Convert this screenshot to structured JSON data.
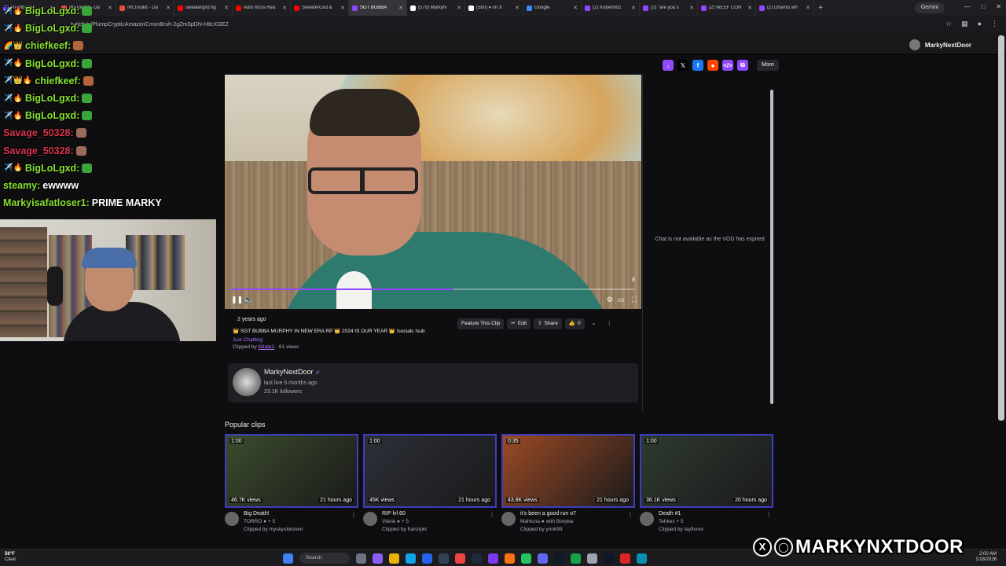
{
  "browser": {
    "tabs": [
      {
        "label": "Dashboard",
        "color": "#9147ff"
      },
      {
        "label": "IRLToolkit - Da",
        "color": "#e74c3c"
      },
      {
        "label": "IRLToolkit - Da",
        "color": "#e74c3c"
      },
      {
        "label": "sweatergxd fig",
        "color": "#ff0000"
      },
      {
        "label": "Adin Ross Rea",
        "color": "#ff0000"
      },
      {
        "label": "SweaterGxd &",
        "color": "#ff0000"
      },
      {
        "label": "SGT BUBBA",
        "color": "#9147ff",
        "active": true
      },
      {
        "label": "(579) MarkyN",
        "color": "#ffffff"
      },
      {
        "label": "(580) ♦ on X",
        "color": "#ffffff"
      },
      {
        "label": "Google",
        "color": "#4285f4"
      },
      {
        "label": "(2) Kobe0802",
        "color": "#9147ff"
      },
      {
        "label": "(2) \"are you s",
        "color": "#9147ff"
      },
      {
        "label": "(2) WEEF CON",
        "color": "#9147ff"
      },
      {
        "label": "(2) Dhamis wh",
        "color": "#9147ff"
      }
    ],
    "gemini_label": "Gemini",
    "url": "twitch.tv/PlumpCrypticAmazonCmonBruh-2gZmSpDN-H8cXGEZ"
  },
  "header": {
    "account_name": "MarkyNextDoor"
  },
  "share": {
    "more_label": "More",
    "buttons": [
      {
        "name": "download-icon",
        "glyph": "↓",
        "color": "#9147ff"
      },
      {
        "name": "x-icon",
        "glyph": "𝕏",
        "color": "#000000"
      },
      {
        "name": "facebook-icon",
        "glyph": "f",
        "color": "#1877f2"
      },
      {
        "name": "reddit-icon",
        "glyph": "●",
        "color": "#ff4500"
      },
      {
        "name": "embed-icon",
        "glyph": "</>",
        "color": "#9147ff"
      },
      {
        "name": "copy-icon",
        "glyph": "⧉",
        "color": "#9147ff"
      }
    ]
  },
  "video": {
    "progress": 0.55,
    "corner_number": "8"
  },
  "clip": {
    "date": "2 years ago",
    "title": "👑 SGT BUBBA MURPHY IN NEW ERA RP 👑 2024 IS OUR YEAR 👑 !socials !sub",
    "game": "Just Chatting",
    "clipped_prefix": "Clipped by ",
    "clipped_by": "lildata1",
    "views": " · 61 views",
    "actions": {
      "feature": "Feature This Clip",
      "edit": "Edit",
      "share": "Share",
      "likes": "0"
    }
  },
  "channel": {
    "name": "MarkyNextDoor",
    "last_live": "last live 5 months ago",
    "followers": "23.1K followers"
  },
  "chat_panel": {
    "message": "Chat is not available as the VOD has expired"
  },
  "popular": {
    "heading": "Popular clips",
    "clips": [
      {
        "duration": "1:00",
        "views": "46.7K views",
        "ago": "21 hours ago",
        "title": "Big Death!",
        "channel": "TORRO ● + 5",
        "by": "Clipped by myskyukkonen",
        "bg": "#3b4b2c"
      },
      {
        "duration": "1:00",
        "views": "45K views",
        "ago": "21 hours ago",
        "title": "RIP lvl 60",
        "channel": "Vilesk ● + 5",
        "by": "Clipped by franzipkt",
        "bg": "#2c2f38"
      },
      {
        "duration": "0:35",
        "views": "43.8K views",
        "ago": "21 hours ago",
        "title": "it's been a good run o7",
        "channel": "Mahluna ● with Bonjwa",
        "by": "Clipped by ynnk99",
        "bg": "#9c4a26"
      },
      {
        "duration": "1:00",
        "views": "36.1K views",
        "ago": "20 hours ago",
        "title": "Death #1",
        "channel": "Tehkex + 5",
        "by": "Clipped by tayflorex",
        "bg": "#2e3a30"
      }
    ]
  },
  "overlay_chat": [
    {
      "user": "BigLoLgxd:",
      "msg": "",
      "color": "#8ae234",
      "badges": "✈️🔥",
      "emote": "#3aa63a"
    },
    {
      "user": "BigLoLgxd:",
      "msg": "",
      "color": "#8ae234",
      "badges": "✈️🔥",
      "emote": "#3aa63a"
    },
    {
      "user": "chiefkeef:",
      "msg": "",
      "color": "#8ae234",
      "badges": "🌈👑",
      "emote": "#b5653b"
    },
    {
      "user": "BigLoLgxd:",
      "msg": "",
      "color": "#8ae234",
      "badges": "✈️🔥",
      "emote": "#3aa63a"
    },
    {
      "user": "chiefkeef:",
      "msg": "",
      "color": "#8ae234",
      "badges": "✈️👑🔥",
      "emote": "#b5653b"
    },
    {
      "user": "BigLoLgxd:",
      "msg": "",
      "color": "#8ae234",
      "badges": "✈️🔥",
      "emote": "#3aa63a"
    },
    {
      "user": "BigLoLgxd:",
      "msg": "",
      "color": "#8ae234",
      "badges": "✈️🔥",
      "emote": "#3aa63a"
    },
    {
      "user": "Savage_50328:",
      "msg": "",
      "color": "#d9364f",
      "badges": "",
      "emote": "#9a6a5a"
    },
    {
      "user": "Savage_50328:",
      "msg": "",
      "color": "#d9364f",
      "badges": "",
      "emote": "#9a6a5a"
    },
    {
      "user": "BigLoLgxd:",
      "msg": "",
      "color": "#8ae234",
      "badges": "✈️🔥",
      "emote": "#3aa63a"
    },
    {
      "user": "steamy:",
      "msg": "ewwww",
      "color": "#8ae234",
      "badges": "",
      "emote": ""
    },
    {
      "user": "Markyisafatloser1:",
      "msg": "PRIME MARKY",
      "color": "#8ae234",
      "badges": "",
      "emote": ""
    }
  ],
  "taskbar": {
    "temp": "56°F",
    "condition": "Clear",
    "search": "Search",
    "time": "2:00 AM",
    "date": "1/18/2026"
  },
  "brand": {
    "name": "MARKYNXTDOOR"
  }
}
